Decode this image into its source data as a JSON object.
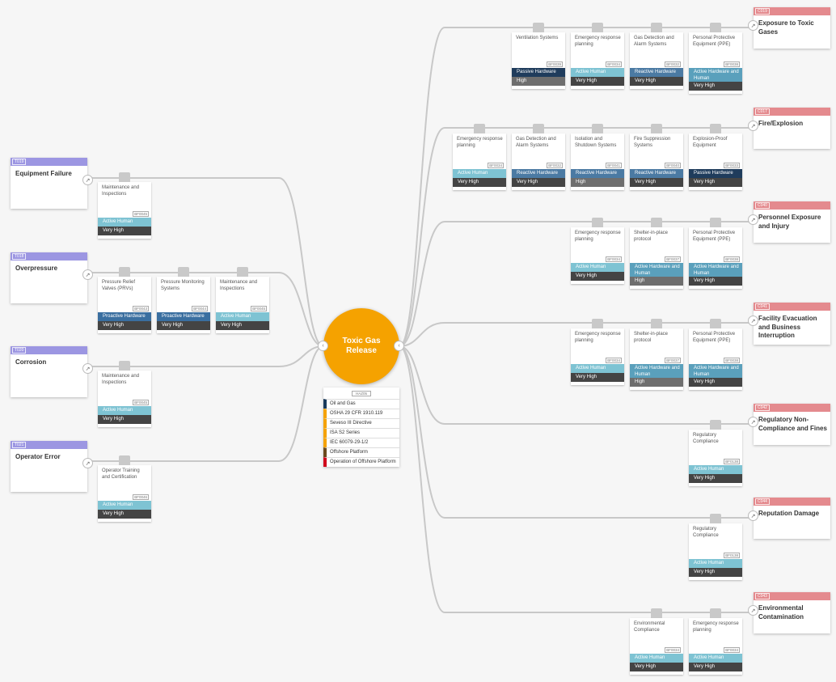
{
  "top_event": {
    "title": "Toxic Gas Release",
    "left_handle": "‹",
    "right_handle": "‹"
  },
  "hazard": {
    "code": "HAZ05",
    "items": [
      {
        "label": "Oil and Gas",
        "color": "#1a3a5c"
      },
      {
        "label": "OSHA 29 CFR 1910.119",
        "color": "#f5a200"
      },
      {
        "label": "Seveso III Directive",
        "color": "#f5a200"
      },
      {
        "label": "ISA S2 Series",
        "color": "#f5a200"
      },
      {
        "label": "IEC 60079-29-1/2",
        "color": "#f5a200"
      },
      {
        "label": "Offshore Platform",
        "color": "#6b4a1e"
      },
      {
        "label": "Operation of Offshore Platform",
        "color": "#d0021b"
      }
    ]
  },
  "colors": {
    "threat_accent": "#9c96e2",
    "consequence_accent": "#e48a8e",
    "active_human": "#7ec3d3",
    "reactive_hardware": "#4b7aa3",
    "proactive_hardware": "#3a6fa0",
    "passive_hardware": "#1f3c5c",
    "active_hardware_human": "#5aa0bc"
  },
  "threats": [
    {
      "code": "T019",
      "title": "Equipment Failure",
      "expand": "↗",
      "barriers": [
        {
          "name": "Maintenance and Inspections",
          "id": "BF0045",
          "type": "Active Human",
          "effectiveness": "Very High"
        }
      ]
    },
    {
      "code": "T018",
      "title": "Overpressure",
      "expand": "↗",
      "barriers": [
        {
          "name": "Pressure Relief Valves (PRVs)",
          "id": "BF0043",
          "type": "Proactive Hardware",
          "effectiveness": "Very High"
        },
        {
          "name": "Pressure Monitoring Systems",
          "id": "BF0044",
          "type": "Proactive Hardware",
          "effectiveness": "Very High"
        },
        {
          "name": "Maintenance and Inspections",
          "id": "BF0045",
          "type": "Active Human",
          "effectiveness": "Very High"
        }
      ]
    },
    {
      "code": "T020",
      "title": "Corrosion",
      "expand": "↗",
      "barriers": [
        {
          "name": "Maintenance and Inspections",
          "id": "BF0045",
          "type": "Active Human",
          "effectiveness": "Very High"
        }
      ]
    },
    {
      "code": "T021",
      "title": "Operator Error",
      "expand": "↗",
      "barriers": [
        {
          "name": "Operator Training and Certification",
          "id": "BF0046",
          "type": "Active Human",
          "effectiveness": "Very High"
        }
      ]
    }
  ],
  "consequences": [
    {
      "code": "C019",
      "title": "Exposure to Toxic Gases",
      "expand": "↗",
      "barriers": [
        {
          "name": "Ventilation Systems",
          "id": "BF0039",
          "type": "Passive Hardware",
          "effectiveness": "High"
        },
        {
          "name": "Emergency response planning",
          "id": "BF0034",
          "type": "Active Human",
          "effectiveness": "Very High"
        },
        {
          "name": "Gas Detection and Alarm Systems",
          "id": "BF0032",
          "type": "Reactive Hardware",
          "effectiveness": "Very High"
        },
        {
          "name": "Personal Protective Equipment (PPE)",
          "id": "BF0038",
          "type": "Active Hardware and Human",
          "effectiveness": "Very High"
        }
      ]
    },
    {
      "code": "C017",
      "title": "Fire/Explosion",
      "expand": "↗",
      "barriers": [
        {
          "name": "Emergency response planning",
          "id": "BF0034",
          "type": "Active Human",
          "effectiveness": "Very High"
        },
        {
          "name": "Gas Detection and Alarm Systems",
          "id": "BF0032",
          "type": "Reactive Hardware",
          "effectiveness": "Very High"
        },
        {
          "name": "Isolation and Shutdown Systems",
          "id": "BF0041",
          "type": "Reactive Hardware",
          "effectiveness": "High"
        },
        {
          "name": "Fire Suppression Systems",
          "id": "BF0040",
          "type": "Reactive Hardware",
          "effectiveness": "Very High"
        },
        {
          "name": "Explosion-Proof Equipment",
          "id": "BF0033",
          "type": "Passive Hardware",
          "effectiveness": "Very High"
        }
      ]
    },
    {
      "code": "C040",
      "title": "Personnel Exposure and Injury",
      "expand": "↗",
      "barriers": [
        {
          "name": "Emergency response planning",
          "id": "BF0034",
          "type": "Active Human",
          "effectiveness": "Very High"
        },
        {
          "name": "Shelter-in-place protocol",
          "id": "BF0037",
          "type": "Active Hardware and Human",
          "effectiveness": "High"
        },
        {
          "name": "Personal Protective Equipment (PPE)",
          "id": "BF0038",
          "type": "Active Hardware and Human",
          "effectiveness": "Very High"
        }
      ]
    },
    {
      "code": "C041",
      "title": "Facility Evacuation and Business Interruption",
      "expand": "↗",
      "barriers": [
        {
          "name": "Emergency response planning",
          "id": "BF0034",
          "type": "Active Human",
          "effectiveness": "Very High"
        },
        {
          "name": "Shelter-in-place protocol",
          "id": "BF0037",
          "type": "Active Hardware and Human",
          "effectiveness": "High"
        },
        {
          "name": "Personal Protective Equipment (PPE)",
          "id": "BF0038",
          "type": "Active Hardware and Human",
          "effectiveness": "Very High"
        }
      ]
    },
    {
      "code": "C042",
      "title": "Regulatory Non-Compliance and Fines",
      "expand": "↗",
      "barriers": [
        {
          "name": "Regulatory Compliance",
          "id": "BF0138",
          "type": "Active Human",
          "effectiveness": "Very High"
        }
      ]
    },
    {
      "code": "C044",
      "title": "Reputation Damage",
      "expand": "↗",
      "barriers": [
        {
          "name": "Regulatory Compliance",
          "id": "BF0138",
          "type": "Active Human",
          "effectiveness": "Very High"
        }
      ]
    },
    {
      "code": "C043",
      "title": "Environmental Contamination",
      "expand": "↗",
      "barriers": [
        {
          "name": "Environmental Compliance",
          "id": "BF0034",
          "type": "Active Human",
          "effectiveness": "Very High"
        },
        {
          "name": "Emergency response planning",
          "id": "BF0034",
          "type": "Active Human",
          "effectiveness": "Very High"
        }
      ]
    }
  ]
}
